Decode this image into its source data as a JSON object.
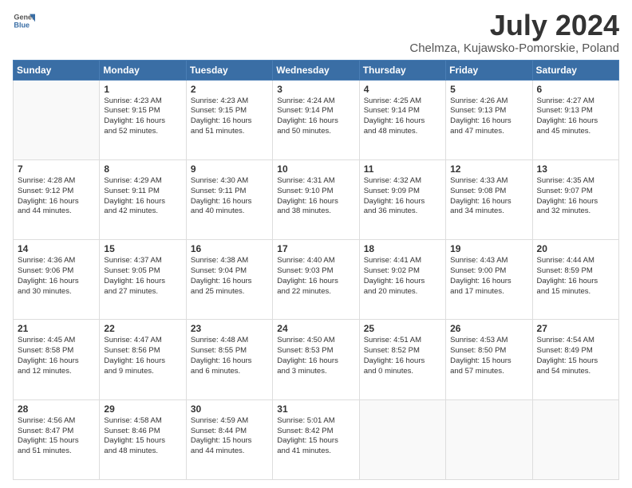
{
  "header": {
    "logo_line1": "General",
    "logo_line2": "Blue",
    "main_title": "July 2024",
    "subtitle": "Chelmza, Kujawsko-Pomorskie, Poland"
  },
  "days_of_week": [
    "Sunday",
    "Monday",
    "Tuesday",
    "Wednesday",
    "Thursday",
    "Friday",
    "Saturday"
  ],
  "weeks": [
    [
      {
        "day": "",
        "info": ""
      },
      {
        "day": "1",
        "info": "Sunrise: 4:23 AM\nSunset: 9:15 PM\nDaylight: 16 hours\nand 52 minutes."
      },
      {
        "day": "2",
        "info": "Sunrise: 4:23 AM\nSunset: 9:15 PM\nDaylight: 16 hours\nand 51 minutes."
      },
      {
        "day": "3",
        "info": "Sunrise: 4:24 AM\nSunset: 9:14 PM\nDaylight: 16 hours\nand 50 minutes."
      },
      {
        "day": "4",
        "info": "Sunrise: 4:25 AM\nSunset: 9:14 PM\nDaylight: 16 hours\nand 48 minutes."
      },
      {
        "day": "5",
        "info": "Sunrise: 4:26 AM\nSunset: 9:13 PM\nDaylight: 16 hours\nand 47 minutes."
      },
      {
        "day": "6",
        "info": "Sunrise: 4:27 AM\nSunset: 9:13 PM\nDaylight: 16 hours\nand 45 minutes."
      }
    ],
    [
      {
        "day": "7",
        "info": "Sunrise: 4:28 AM\nSunset: 9:12 PM\nDaylight: 16 hours\nand 44 minutes."
      },
      {
        "day": "8",
        "info": "Sunrise: 4:29 AM\nSunset: 9:11 PM\nDaylight: 16 hours\nand 42 minutes."
      },
      {
        "day": "9",
        "info": "Sunrise: 4:30 AM\nSunset: 9:11 PM\nDaylight: 16 hours\nand 40 minutes."
      },
      {
        "day": "10",
        "info": "Sunrise: 4:31 AM\nSunset: 9:10 PM\nDaylight: 16 hours\nand 38 minutes."
      },
      {
        "day": "11",
        "info": "Sunrise: 4:32 AM\nSunset: 9:09 PM\nDaylight: 16 hours\nand 36 minutes."
      },
      {
        "day": "12",
        "info": "Sunrise: 4:33 AM\nSunset: 9:08 PM\nDaylight: 16 hours\nand 34 minutes."
      },
      {
        "day": "13",
        "info": "Sunrise: 4:35 AM\nSunset: 9:07 PM\nDaylight: 16 hours\nand 32 minutes."
      }
    ],
    [
      {
        "day": "14",
        "info": "Sunrise: 4:36 AM\nSunset: 9:06 PM\nDaylight: 16 hours\nand 30 minutes."
      },
      {
        "day": "15",
        "info": "Sunrise: 4:37 AM\nSunset: 9:05 PM\nDaylight: 16 hours\nand 27 minutes."
      },
      {
        "day": "16",
        "info": "Sunrise: 4:38 AM\nSunset: 9:04 PM\nDaylight: 16 hours\nand 25 minutes."
      },
      {
        "day": "17",
        "info": "Sunrise: 4:40 AM\nSunset: 9:03 PM\nDaylight: 16 hours\nand 22 minutes."
      },
      {
        "day": "18",
        "info": "Sunrise: 4:41 AM\nSunset: 9:02 PM\nDaylight: 16 hours\nand 20 minutes."
      },
      {
        "day": "19",
        "info": "Sunrise: 4:43 AM\nSunset: 9:00 PM\nDaylight: 16 hours\nand 17 minutes."
      },
      {
        "day": "20",
        "info": "Sunrise: 4:44 AM\nSunset: 8:59 PM\nDaylight: 16 hours\nand 15 minutes."
      }
    ],
    [
      {
        "day": "21",
        "info": "Sunrise: 4:45 AM\nSunset: 8:58 PM\nDaylight: 16 hours\nand 12 minutes."
      },
      {
        "day": "22",
        "info": "Sunrise: 4:47 AM\nSunset: 8:56 PM\nDaylight: 16 hours\nand 9 minutes."
      },
      {
        "day": "23",
        "info": "Sunrise: 4:48 AM\nSunset: 8:55 PM\nDaylight: 16 hours\nand 6 minutes."
      },
      {
        "day": "24",
        "info": "Sunrise: 4:50 AM\nSunset: 8:53 PM\nDaylight: 16 hours\nand 3 minutes."
      },
      {
        "day": "25",
        "info": "Sunrise: 4:51 AM\nSunset: 8:52 PM\nDaylight: 16 hours\nand 0 minutes."
      },
      {
        "day": "26",
        "info": "Sunrise: 4:53 AM\nSunset: 8:50 PM\nDaylight: 15 hours\nand 57 minutes."
      },
      {
        "day": "27",
        "info": "Sunrise: 4:54 AM\nSunset: 8:49 PM\nDaylight: 15 hours\nand 54 minutes."
      }
    ],
    [
      {
        "day": "28",
        "info": "Sunrise: 4:56 AM\nSunset: 8:47 PM\nDaylight: 15 hours\nand 51 minutes."
      },
      {
        "day": "29",
        "info": "Sunrise: 4:58 AM\nSunset: 8:46 PM\nDaylight: 15 hours\nand 48 minutes."
      },
      {
        "day": "30",
        "info": "Sunrise: 4:59 AM\nSunset: 8:44 PM\nDaylight: 15 hours\nand 44 minutes."
      },
      {
        "day": "31",
        "info": "Sunrise: 5:01 AM\nSunset: 8:42 PM\nDaylight: 15 hours\nand 41 minutes."
      },
      {
        "day": "",
        "info": ""
      },
      {
        "day": "",
        "info": ""
      },
      {
        "day": "",
        "info": ""
      }
    ]
  ]
}
